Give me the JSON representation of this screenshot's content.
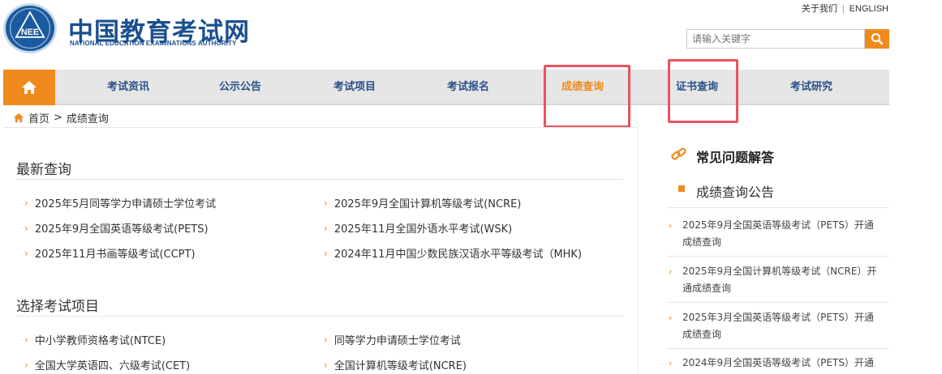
{
  "header": {
    "logo_text": "NEE",
    "brand_cn": "中国教育考试网",
    "brand_en": "NATIONAL EDUCATION EXAMINATIONS AUTHORITY",
    "top_links": [
      "关于我们",
      "ENGLISH"
    ],
    "search_placeholder": "请输入关键字"
  },
  "nav": {
    "items": [
      "考试资讯",
      "公示公告",
      "考试项目",
      "考试报名",
      "成绩查询",
      "证书查询",
      "考试研究"
    ],
    "active": "成绩查询"
  },
  "breadcrumb": {
    "home": "首页",
    "separator": ">",
    "current": "成绩查询"
  },
  "latest": {
    "title": "最新查询",
    "left": [
      "2025年5月同等学力申请硕士学位考试",
      "2025年9月全国英语等级考试(PETS)",
      "2025年11月书画等级考试(CCPT)"
    ],
    "right": [
      "2025年9月全国计算机等级考试(NCRE)",
      "2025年11月全国外语水平考试(WSK)",
      "2024年11月中国少数民族汉语水平等级考试（MHK)"
    ]
  },
  "choose": {
    "title": "选择考试项目",
    "left": [
      "中小学教师资格考试(NTCE)",
      "全国大学英语四、六级考试(CET)"
    ],
    "right": [
      "同等学力申请硕士学位考试",
      "全国计算机等级考试(NCRE)"
    ]
  },
  "sidebar": {
    "faq_title": "常见问题解答",
    "sub_title": "成绩查询公告",
    "notices": [
      [
        "2025年9月全国英语等级考试（PETS）开通",
        "成绩查询"
      ],
      [
        "2025年9月全国计算机等级考试（NCRE）开",
        "通成绩查询"
      ],
      [
        "2025年3月全国英语等级考试（PETS）开通",
        "成绩查询"
      ],
      [
        "2024年9月全国英语等级考试（PETS）开通",
        ""
      ]
    ]
  },
  "colors": {
    "accent": "#f08a1c",
    "brand": "#1a4f8f",
    "highlight_box": "#e8545f",
    "nav_bg": "#e6e6e6"
  }
}
